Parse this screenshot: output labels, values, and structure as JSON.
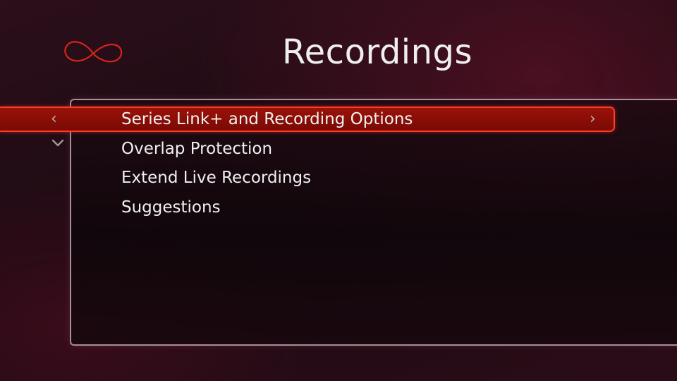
{
  "screen": {
    "title": "Recordings",
    "logo_icon": "infinity-logo-icon"
  },
  "menu": {
    "selected_index": 0,
    "items": [
      {
        "label": "Series Link+ and Recording Options"
      },
      {
        "label": "Overlap Protection"
      },
      {
        "label": "Extend Live Recordings"
      },
      {
        "label": "Suggestions"
      }
    ]
  },
  "nav": {
    "left_icon": "chevron-left-icon",
    "right_icon": "chevron-right-icon",
    "down_icon": "chevron-down-icon"
  },
  "colors": {
    "accent": "#d8241a",
    "highlight": "#8a0e06",
    "panel_border": "#a88d9a"
  }
}
